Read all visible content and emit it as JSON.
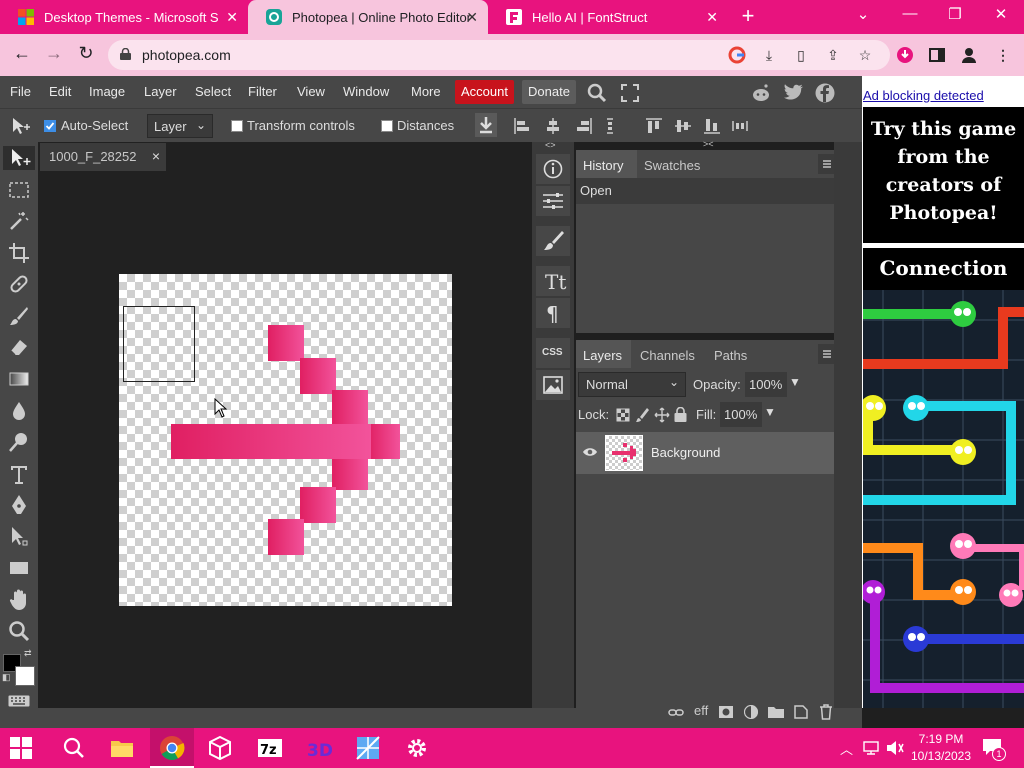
{
  "browser": {
    "tabs": [
      {
        "title": "Desktop Themes - Microsoft Sup",
        "icon": "microsoft-logo"
      },
      {
        "title": "Photopea | Online Photo Editor",
        "icon": "photopea-logo"
      },
      {
        "title": "Hello AI | FontStruct",
        "icon": "fontstruct-logo"
      }
    ],
    "new_tab": "+",
    "url": "photopea.com"
  },
  "menu": {
    "items": [
      "File",
      "Edit",
      "Image",
      "Layer",
      "Select",
      "Filter",
      "View",
      "Window",
      "More"
    ],
    "account": "Account",
    "donate": "Donate"
  },
  "options": {
    "auto_select": "Auto-Select",
    "layer_value": "Layer",
    "transform_controls": "Transform controls",
    "distances": "Distances"
  },
  "document": {
    "tab_title": "1000_F_28252",
    "close": "×"
  },
  "history": {
    "tabs": [
      "History",
      "Swatches"
    ],
    "entries": [
      "Open"
    ]
  },
  "layers": {
    "tabs": [
      "Layers",
      "Channels",
      "Paths"
    ],
    "blend_mode": "Normal",
    "opacity_label": "Opacity:",
    "opacity_value": "100%",
    "lock_label": "Lock:",
    "fill_label": "Fill:",
    "fill_value": "100%",
    "items": [
      {
        "name": "Background",
        "visible": true
      }
    ]
  },
  "panel_strip": {
    "css_label": "CSS"
  },
  "ad": {
    "notice": "Ad blocking detected",
    "top_text": "Try this game from the creators of Photopea!",
    "game_title": "Connection"
  },
  "taskbar": {
    "time": "7:19 PM",
    "date": "10/13/2023",
    "notification_count": "1"
  },
  "colors": {
    "chrome_accent": "#e8137e",
    "arrow_pink": "#e8306e",
    "account_red": "#c8131c"
  }
}
